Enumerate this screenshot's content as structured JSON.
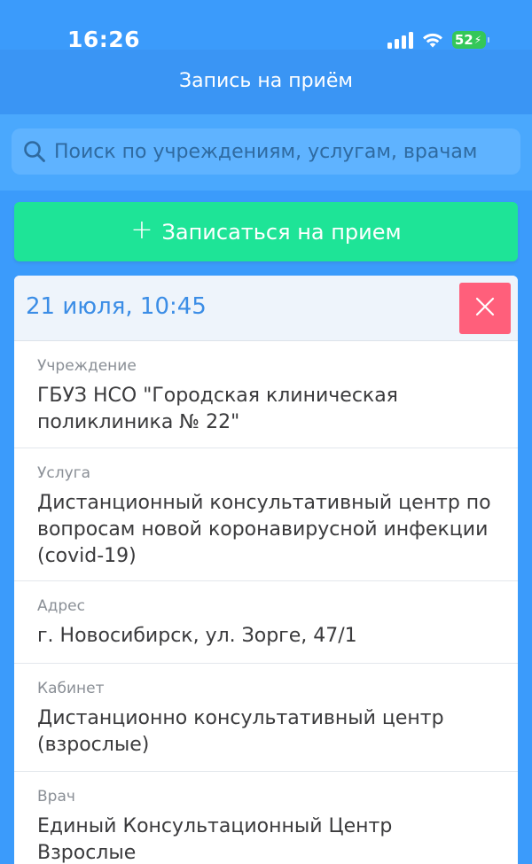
{
  "status_bar": {
    "time": "16:26",
    "battery_level": "52",
    "battery_charging_glyph": "⚡"
  },
  "header": {
    "title": "Запись на приём"
  },
  "search": {
    "placeholder": "Поиск по учреждениям, услугам, врачам"
  },
  "book_button": {
    "label": "Записаться на прием",
    "icon": "plus-icon"
  },
  "appointment": {
    "datetime": "21 июля, 10:45",
    "cancel_icon": "close-icon",
    "fields": {
      "institution": {
        "label": "Учреждение",
        "value": "ГБУЗ НСО \"Городская клиническая поликлиника № 22\""
      },
      "service": {
        "label": "Услуга",
        "value": "Дистанционный консультативный центр по вопросам новой коронавирусной инфекции (covid-19)"
      },
      "address": {
        "label": "Адрес",
        "value": "г. Новосибирск, ул. Зорге, 47/1"
      },
      "cabinet": {
        "label": "Кабинет",
        "value": "Дистанционно консультативный центр (взрослые)"
      },
      "doctor": {
        "label": "Врач",
        "value": "Единый Консультационный Центр Взрослые"
      }
    }
  },
  "colors": {
    "primary_blue": "#3b9bfb",
    "header_blue": "#3a95f4",
    "search_bg": "#4aa8fd",
    "accent_green": "#1ee497",
    "cancel_red": "#ff5f7b",
    "datetime_blue": "#3b8de6"
  }
}
